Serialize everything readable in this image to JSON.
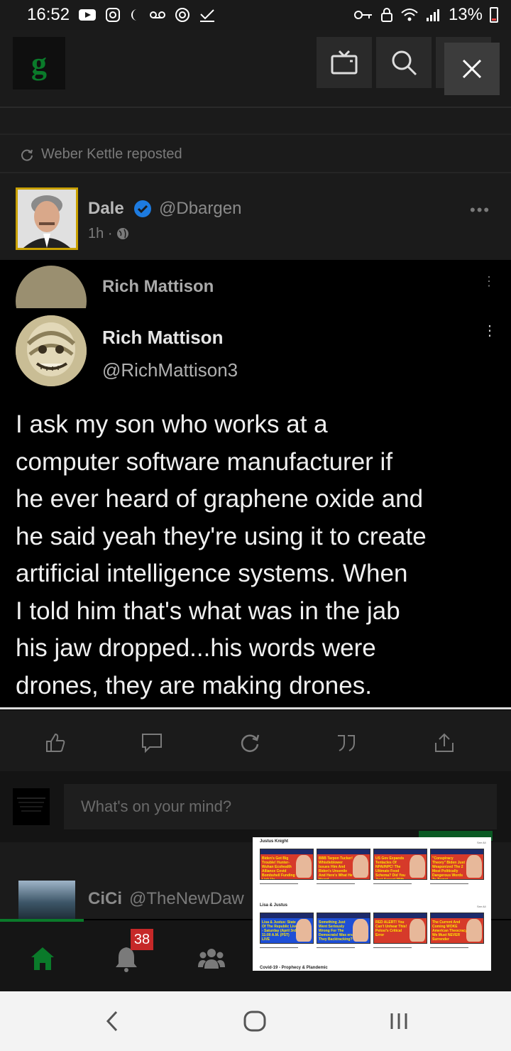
{
  "status_bar": {
    "time": "16:52",
    "battery_percent": "13%",
    "icons_left": [
      "youtube-icon",
      "instagram-icon",
      "moon-icon",
      "voicemail-icon",
      "nfc-icon",
      "check-icon"
    ],
    "icons_right": [
      "key-icon",
      "lock-icon",
      "wifi-icon",
      "signal-icon",
      "battery-icon"
    ]
  },
  "header": {
    "logo_letter": "g",
    "buttons": [
      "tv-icon",
      "search-icon",
      "close-icon"
    ],
    "accent_color": "#0a7a2a"
  },
  "feed": {
    "repost_label": "Weber Kettle reposted",
    "post": {
      "author_name": "Dale",
      "author_handle": "@Dbargen",
      "time": "1h",
      "visibility_icon": "globe-icon"
    },
    "tweet": {
      "ghost_name": "Rich Mattison",
      "author_name": "Rich Mattison",
      "author_handle": "@RichMattison3",
      "lines": [
        "I ask my son who works at a",
        "computer software manufacturer if",
        "he ever heard of graphene oxide and",
        "he said yeah they're using it to create",
        "artificial intelligence systems.  When",
        "I told him that's what was in the jab",
        "his jaw dropped...his words were",
        "drones, they are making drones."
      ]
    },
    "actions": [
      "like-icon",
      "comment-icon",
      "repost-icon",
      "quote-icon",
      "share-icon"
    ],
    "composer_placeholder": "What's on your mind?",
    "next_post": {
      "author_name": "CiCi",
      "author_handle": "@TheNewDaw"
    }
  },
  "bottom_nav": {
    "items": [
      "home-icon",
      "notifications-icon",
      "groups-icon"
    ],
    "notification_count": "38"
  },
  "pip": {
    "section1_title": "Justus Knight",
    "section2_title": "Lisa & Justus",
    "section3_title": "Covid-19 - Prophecy & Plandemic",
    "view_all": "See All",
    "row1": [
      "Biden's Got Big Trouble! Hunter-Wuhan Ecohealth Alliance Covid Bombshell Funding Link Up",
      "BBB Tarpon Tucker! Whistleblower Issues Him And Biden's Unsenile And Here's What He Heard",
      "US Gov Expands Tentacles Of NPAI/NPC! The Ultimate Food Schema? Did You Just Accept With Open Arms?",
      "\"Conspiracy Theory\" Biden Just Weaponized The 2 Most Politically Dangerous Words To Target"
    ],
    "row2": [
      "Lisa & Justus: State Of The Republic Live - Saturday (April 3rd) 11:00 A.M. (PST) LIVE",
      "Something Just Went Seriously Wrong For The Democrats! Was ers They Backtracking?",
      "RED ALERT! You Can't Unhear This! Pelosi's Critical Error",
      "The Current And Coming WOKE American Theocracy We Must NEVER Surrender"
    ]
  }
}
